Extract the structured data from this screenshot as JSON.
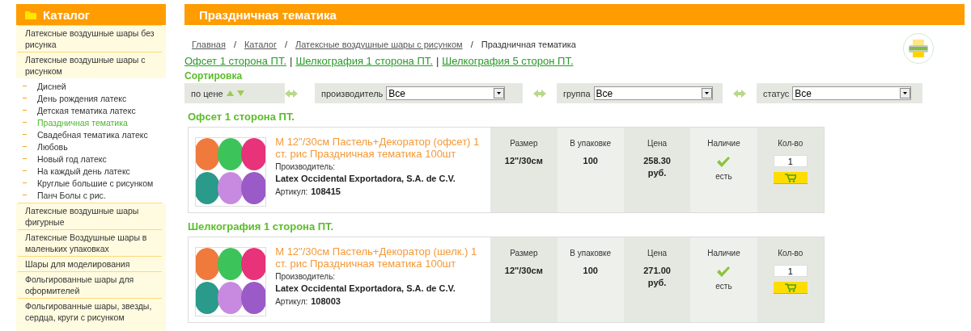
{
  "sidebar": {
    "title": "Каталог",
    "items": [
      {
        "label": "Латексные воздушные шары без рисунка",
        "selected": false
      },
      {
        "label": "Латексные воздушные шары с рисунком",
        "selected": false,
        "children": [
          {
            "label": "Дисней",
            "selected": false
          },
          {
            "label": "День рождения латекс",
            "selected": false
          },
          {
            "label": "Детская тематика латекс",
            "selected": false
          },
          {
            "label": "Праздничная тематика",
            "selected": true
          },
          {
            "label": "Свадебная тематика латекс",
            "selected": false
          },
          {
            "label": "Любовь",
            "selected": false
          },
          {
            "label": "Новый год латекс",
            "selected": false
          },
          {
            "label": "На каждый день латекс",
            "selected": false
          },
          {
            "label": "Круглые большие с рисунком",
            "selected": false
          },
          {
            "label": "Панч Болы с рис.",
            "selected": false
          }
        ]
      },
      {
        "label": "Латексные воздушные шары фигурные",
        "selected": false
      },
      {
        "label": "Латексные Воздушные шары в маленьких упаковках",
        "selected": false
      },
      {
        "label": "Шары для моделирования",
        "selected": false
      },
      {
        "label": "Фольгированные шары для оформителей",
        "selected": false
      },
      {
        "label": "Фольгированные шары, звезды, сердца, круги с рисунком",
        "selected": false
      }
    ]
  },
  "page_title": "Праздничная тематика",
  "breadcrumbs": [
    {
      "label": "Главная",
      "kind": "link"
    },
    {
      "label": "/",
      "kind": "separator"
    },
    {
      "label": "Каталог",
      "kind": "link"
    },
    {
      "label": "/",
      "kind": "separator"
    },
    {
      "label": "Латексные воздушные шары с рисунком",
      "kind": "link"
    },
    {
      "label": "/",
      "kind": "separator"
    },
    {
      "label": "Праздничная тематика",
      "kind": "current"
    }
  ],
  "section_links": [
    {
      "label": "Офсет 1 сторона ПТ.",
      "kind": "link"
    },
    {
      "label": "|",
      "kind": "separator"
    },
    {
      "label": "Шелкография 1 сторона ПТ.",
      "kind": "link"
    },
    {
      "label": "|",
      "kind": "separator"
    },
    {
      "label": "Шелкография 5 сторон ПТ.",
      "kind": "link"
    }
  ],
  "sort": {
    "title": "Сортировка",
    "by_price": "по цене",
    "filters": [
      {
        "label": "производитель",
        "value": "Все"
      },
      {
        "label": "группа",
        "value": "Все"
      },
      {
        "label": "статус",
        "value": "Все"
      }
    ]
  },
  "sections": [
    {
      "heading": "Офсет 1 сторона ПТ.",
      "product": {
        "name": "М 12\"/30см Пастель+Декоратор (офсет) 1 ст. рис Праздничная тематика 100шт",
        "manufacturer_label": "Производитель:",
        "manufacturer": "Latex Occidental Exportadora, S.A. de C.V.",
        "article_label": "Артикул:",
        "article": "108415",
        "columns": [
          {
            "kind": "text",
            "header": "Размер",
            "value": "12\"/30см"
          },
          {
            "kind": "text",
            "header": "В упаковке",
            "value": "100"
          },
          {
            "kind": "price",
            "header": "Цена",
            "value": "258.30",
            "currency": "руб."
          },
          {
            "kind": "stock",
            "header": "Наличие",
            "in_stock": true,
            "value": "есть"
          },
          {
            "kind": "qty",
            "header": "Кол-во",
            "value": "1"
          }
        ]
      }
    },
    {
      "heading": "Шелкография 1 сторона ПТ.",
      "product": {
        "name": "М 12\"/30см Пастель+Декоратор (шелк.) 1 ст. рис Праздничная тематика 100шт",
        "manufacturer_label": "Производитель:",
        "manufacturer": "Latex Occidental Exportadora, S.A. de C.V.",
        "article_label": "Артикул:",
        "article": "108003",
        "columns": [
          {
            "kind": "text",
            "header": "Размер",
            "value": "12\"/30см"
          },
          {
            "kind": "text",
            "header": "В упаковке",
            "value": "100"
          },
          {
            "kind": "price",
            "header": "Цена",
            "value": "271.00",
            "currency": "руб."
          },
          {
            "kind": "stock",
            "header": "Наличие",
            "in_stock": true,
            "value": "есть"
          },
          {
            "kind": "qty",
            "header": "Кол-во",
            "value": "1"
          }
        ]
      }
    }
  ]
}
